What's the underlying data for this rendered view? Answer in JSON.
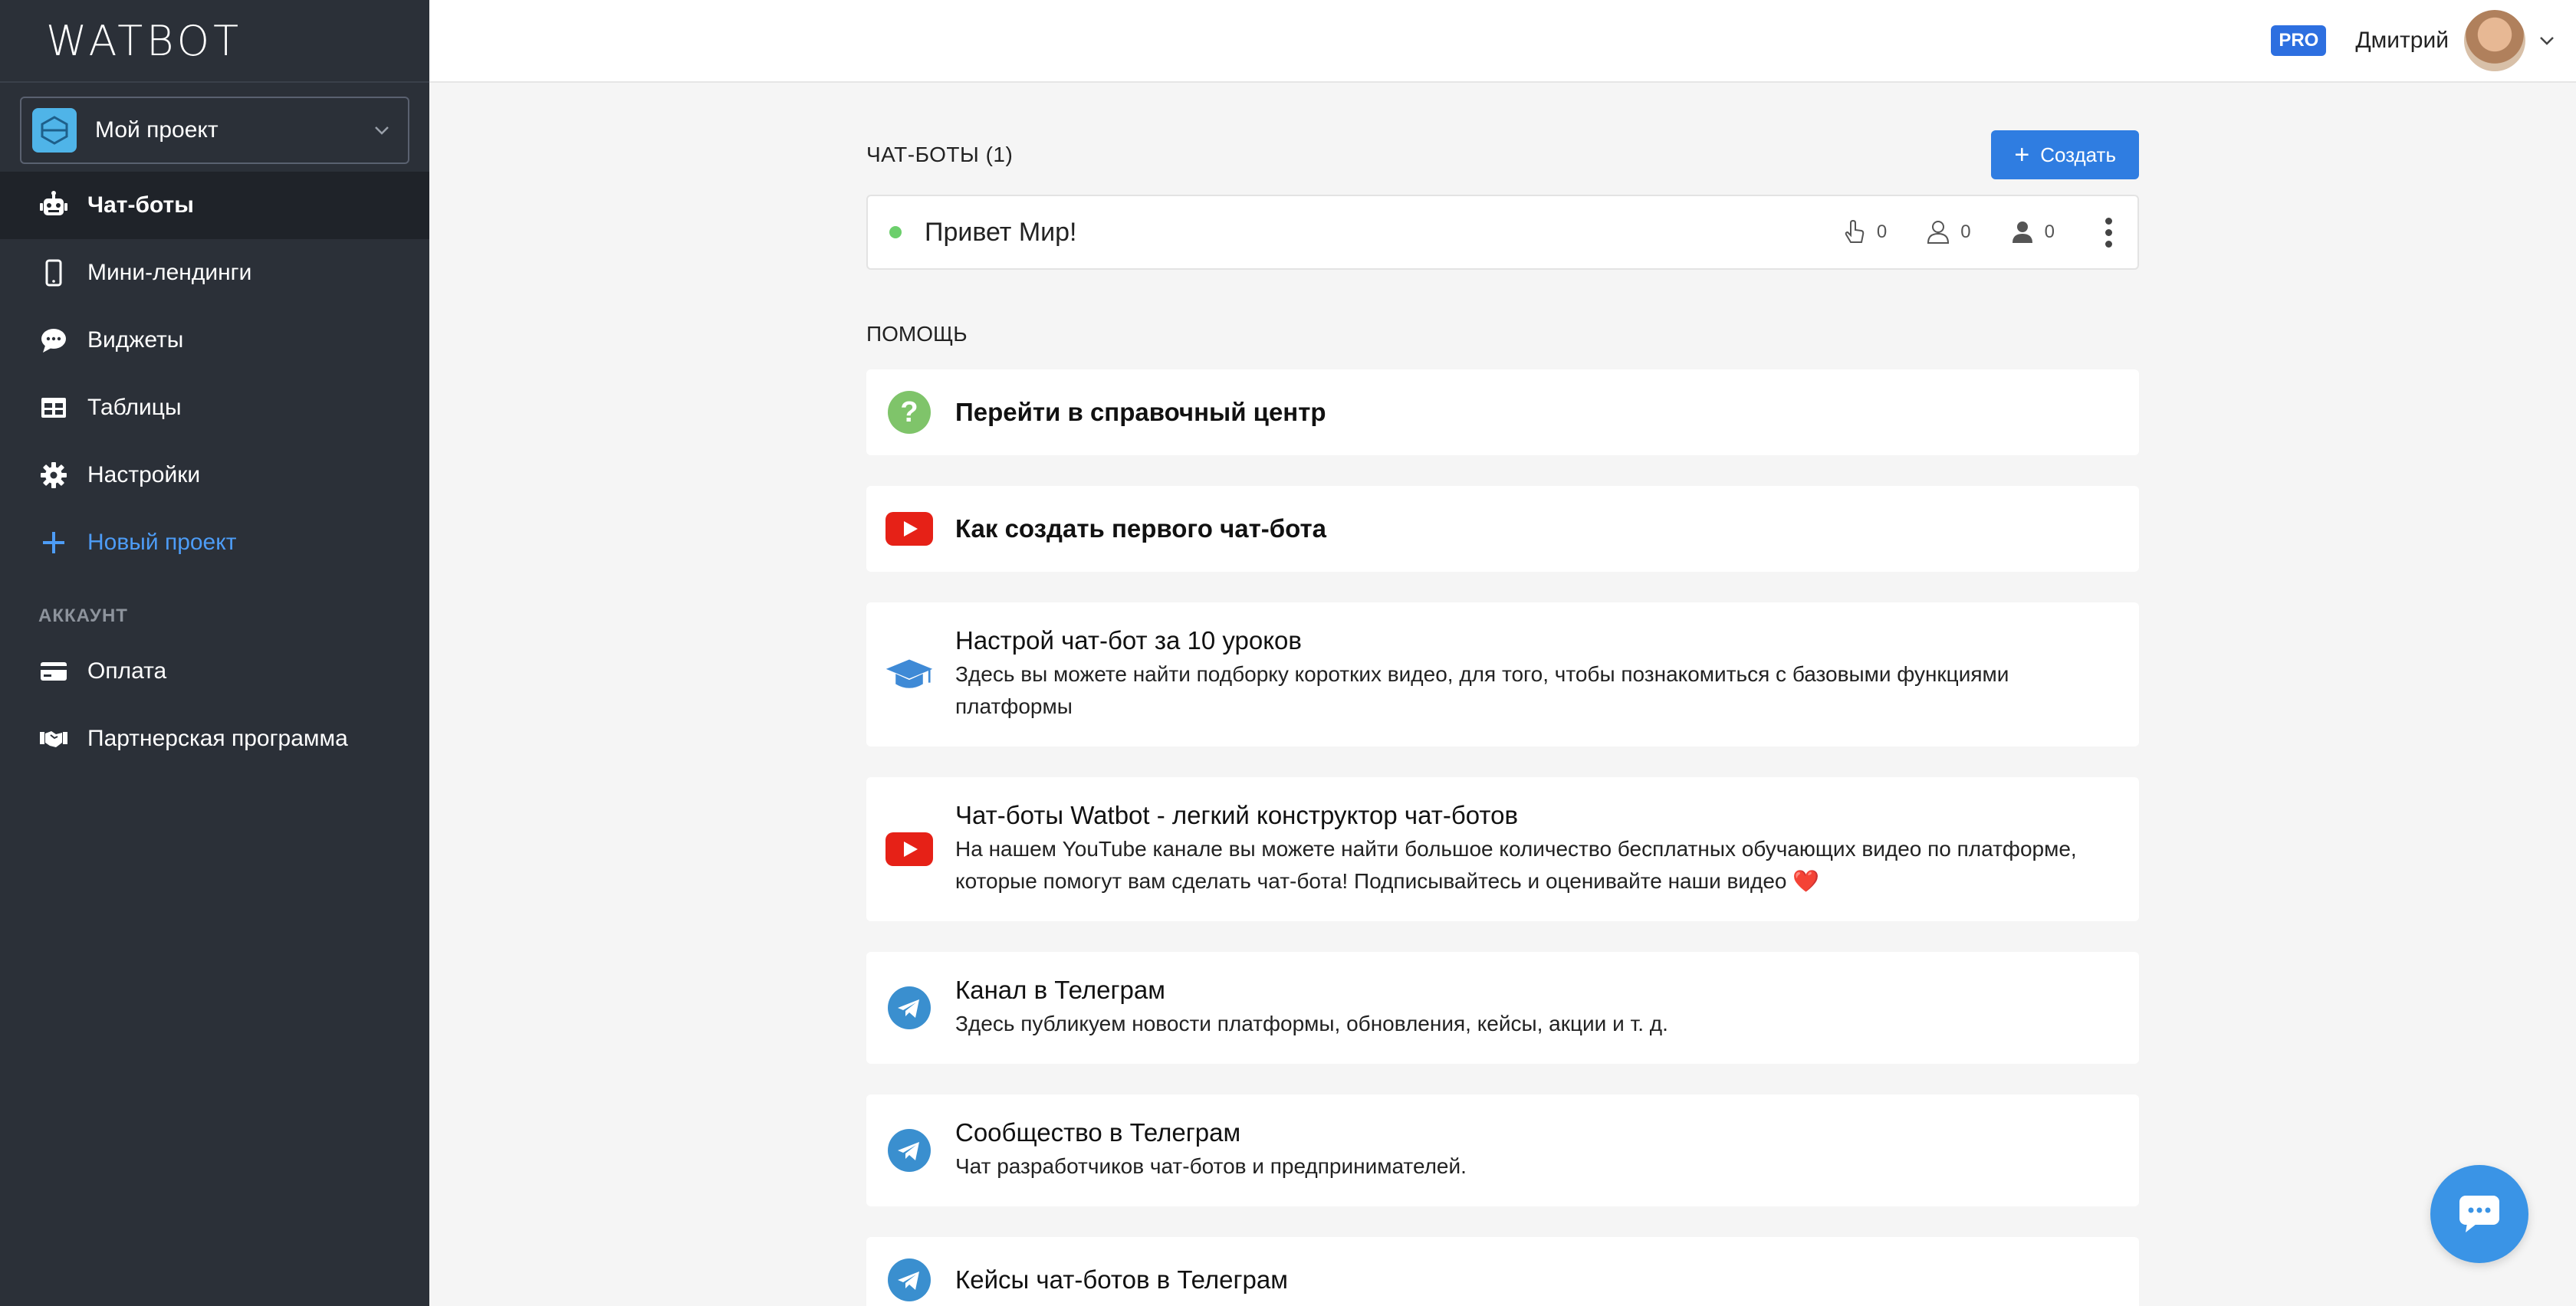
{
  "app": {
    "logo": "WATBOT"
  },
  "sidebar": {
    "project": {
      "name": "Мой проект"
    },
    "items": [
      {
        "label": "Чат-боты",
        "icon": "robot-icon",
        "active": true
      },
      {
        "label": "Мини-лендинги",
        "icon": "smartphone-icon"
      },
      {
        "label": "Виджеты",
        "icon": "chat-bubble-icon"
      },
      {
        "label": "Таблицы",
        "icon": "table-icon"
      },
      {
        "label": "Настройки",
        "icon": "gear-icon"
      },
      {
        "label": "Новый проект",
        "icon": "plus-icon"
      }
    ],
    "account_label": "АККАУНТ",
    "account_items": [
      {
        "label": "Оплата",
        "icon": "credit-card-icon"
      },
      {
        "label": "Партнерская программа",
        "icon": "handshake-icon"
      }
    ]
  },
  "header": {
    "badge": "PRO",
    "username": "Дмитрий"
  },
  "main": {
    "bots_title": "ЧАТ-БОТЫ (1)",
    "create_label": "Создать",
    "bots": [
      {
        "name": "Привет Мир!",
        "status_color": "#6ccf6c",
        "clicks": "0",
        "subscribers": "0",
        "users": "0"
      }
    ],
    "help_title": "ПОМОЩЬ",
    "help": [
      {
        "title": "Перейти в справочный центр",
        "icon": "question-circle-icon"
      },
      {
        "title": "Как создать первого чат-бота",
        "icon": "youtube-icon"
      },
      {
        "title": "Настрой чат-бот за 10 уроков",
        "desc": "Здесь вы можете найти подборку коротких видео, для того, чтобы познакомиться с базовыми функциями платформы",
        "icon": "graduation-cap-icon"
      },
      {
        "title": "Чат-боты Watbot - легкий конструктор чат-ботов",
        "desc": "На нашем YouTube канале вы можете найти большое количество бесплатных обучающих видео по платформе, которые помогут вам сделать чат-бота! Подписывайтесь и оценивайте наши видео ❤️",
        "icon": "youtube-icon"
      },
      {
        "title": "Канал в Телеграм",
        "desc": "Здесь публикуем новости платформы, обновления, кейсы, акции и т. д.",
        "icon": "telegram-icon"
      },
      {
        "title": "Сообщество в Телеграм",
        "desc": "Чат разработчиков чат-ботов и предпринимателей.",
        "icon": "telegram-icon"
      },
      {
        "title": "Кейсы чат-ботов в Телеграм",
        "icon": "telegram-icon"
      }
    ]
  },
  "colors": {
    "sidebar_bg": "#2b3038",
    "accent": "#2f7de1",
    "youtube": "#e62117",
    "telegram": "#3a8fcf"
  }
}
